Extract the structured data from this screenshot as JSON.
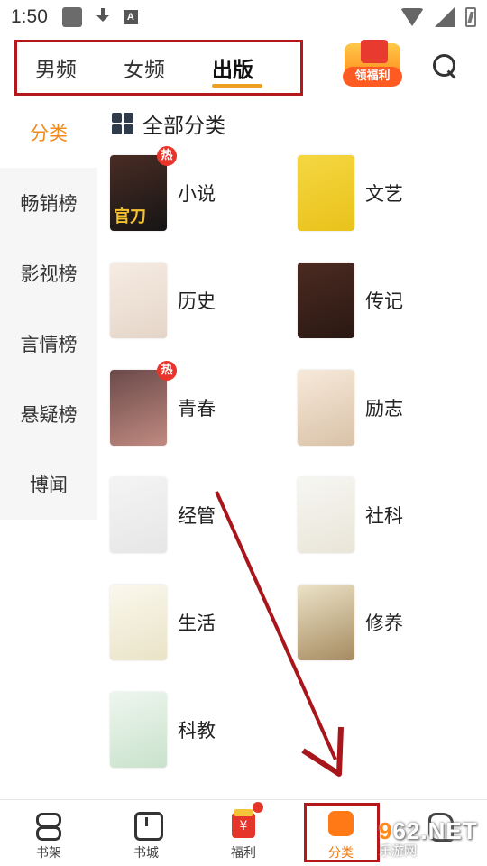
{
  "status_bar": {
    "time": "1:50"
  },
  "top_tabs": [
    {
      "label": "男频",
      "active": false
    },
    {
      "label": "女频",
      "active": false
    },
    {
      "label": "出版",
      "active": true
    }
  ],
  "gift": {
    "label": "领福利"
  },
  "sidebar": {
    "items": [
      {
        "label": "分类",
        "active": true
      },
      {
        "label": "畅销榜",
        "active": false
      },
      {
        "label": "影视榜",
        "active": false
      },
      {
        "label": "言情榜",
        "active": false
      },
      {
        "label": "悬疑榜",
        "active": false
      },
      {
        "label": "博闻",
        "active": false
      }
    ]
  },
  "section": {
    "title": "全部分类"
  },
  "categories": [
    {
      "label": "小说",
      "hot": true,
      "hot_label": "热",
      "cover_text": "官刀",
      "cover_colors": [
        "#4a2c24",
        "#151515"
      ]
    },
    {
      "label": "文艺",
      "hot": false,
      "cover_text": "",
      "cover_colors": [
        "#f5d742",
        "#e9c21a"
      ]
    },
    {
      "label": "历史",
      "hot": false,
      "cover_text": "",
      "cover_colors": [
        "#f6ece3",
        "#e5d5c8"
      ]
    },
    {
      "label": "传记",
      "hot": false,
      "cover_text": "",
      "cover_colors": [
        "#4b2b22",
        "#2a1812"
      ]
    },
    {
      "label": "青春",
      "hot": true,
      "hot_label": "热",
      "cover_text": "",
      "cover_colors": [
        "#6b4a4a",
        "#c08a80"
      ]
    },
    {
      "label": "励志",
      "hot": false,
      "cover_text": "",
      "cover_colors": [
        "#f7e9da",
        "#d9c2a8"
      ]
    },
    {
      "label": "经管",
      "hot": false,
      "cover_text": "",
      "cover_colors": [
        "#f4f4f4",
        "#e6e6e6"
      ]
    },
    {
      "label": "社科",
      "hot": false,
      "cover_text": "",
      "cover_colors": [
        "#f6f6f2",
        "#e9e5d8"
      ]
    },
    {
      "label": "生活",
      "hot": false,
      "cover_text": "",
      "cover_colors": [
        "#fbf8ee",
        "#e9e3c6"
      ]
    },
    {
      "label": "修养",
      "hot": false,
      "cover_text": "",
      "cover_colors": [
        "#ece3c8",
        "#a68b60"
      ]
    },
    {
      "label": "科教",
      "hot": false,
      "cover_text": "",
      "cover_colors": [
        "#eef6ee",
        "#c9e2cc"
      ]
    }
  ],
  "bottom_nav": [
    {
      "label": "书架",
      "icon": "bookshelf-icon",
      "active": false
    },
    {
      "label": "书城",
      "icon": "bookstore-icon",
      "active": false
    },
    {
      "label": "福利",
      "icon": "red-envelope-icon",
      "active": false,
      "badge": true
    },
    {
      "label": "分类",
      "icon": "category-icon",
      "active": true
    },
    {
      "label": "",
      "icon": "profile-icon",
      "active": false
    }
  ],
  "watermark": {
    "top": "962.NET",
    "bottom": "乐游网"
  }
}
